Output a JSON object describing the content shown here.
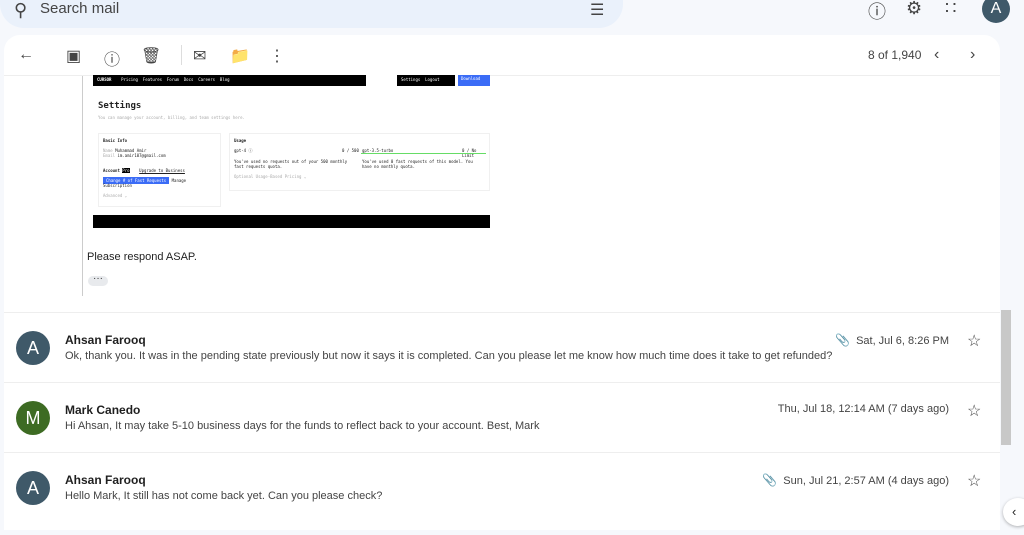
{
  "search": {
    "placeholder": "Search mail"
  },
  "account": {
    "initial": "A"
  },
  "toolbar": {
    "count": "8 of 1,940"
  },
  "embedded": {
    "logo": "CURSOR",
    "nav": [
      "Pricing",
      "Features",
      "Forum",
      "Docs",
      "Careers",
      "Blog"
    ],
    "settings": "Settings",
    "logout": "Logout",
    "download": "Download",
    "title": "Settings",
    "subtitle": "You can manage your account, billing, and team settings here.",
    "basic_info": "Basic Info",
    "name_label": "Name",
    "name": "Muhammad Amir",
    "email_label": "Email",
    "email": "im.amir107@gmail.com",
    "account": "Account",
    "pro": "Pro",
    "upgrade": "Upgrade to Business",
    "change": "Change # of Fast Requests",
    "manage": "Manage Subscription",
    "advanced": "Advanced ⌄",
    "usage": "Usage",
    "gpt4": "gpt-4 ⓘ",
    "gpt4_val": "0 / 500",
    "gpt35": "gpt-3.5-turbo",
    "gpt35_val": "0 / No Limit",
    "gpt4_text": "You've used no requests out of your 500 monthly fast requests quota.",
    "gpt35_text": "You've used 0 fast requests of this model. You have no monthly quota.",
    "optional": "Optional Usage-Based Pricing ⌄"
  },
  "body_text": "Please respond ASAP.",
  "messages": [
    {
      "initial": "A",
      "color": "#3f5969",
      "sender": "Ahsan Farooq",
      "snippet": "Ok, thank you. It was in the pending state previously but now it says it is completed. Can you please let me know how much time does it take to get refunded?",
      "date": "Sat, Jul 6, 8:26 PM",
      "attachment": true
    },
    {
      "initial": "M",
      "color": "#3d6b23",
      "sender": "Mark Canedo",
      "snippet": "Hi Ahsan, It may take 5-10 business days for the funds to reflect back to your account. Best, Mark",
      "date": "Thu, Jul 18, 12:14 AM (7 days ago)",
      "attachment": false
    },
    {
      "initial": "A",
      "color": "#3f5969",
      "sender": "Ahsan Farooq",
      "snippet": "Hello Mark, It still has not come back yet. Can you please check?",
      "date": "Sun, Jul 21, 2:57 AM (4 days ago)",
      "attachment": true
    }
  ]
}
